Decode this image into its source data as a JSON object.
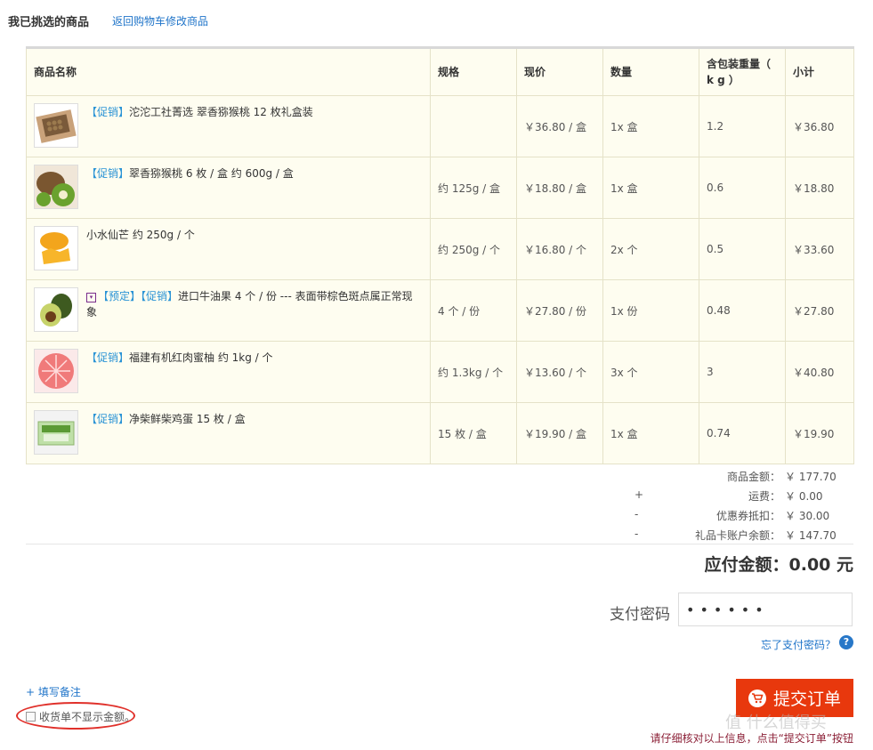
{
  "header": {
    "title": "我已挑选的商品",
    "back_link": "返回购物车修改商品"
  },
  "table": {
    "columns": [
      "商品名称",
      "规格",
      "现价",
      "数量",
      "含包装重量（ k g ）",
      "小计"
    ],
    "rows": [
      {
        "tags": [
          "【促销】"
        ],
        "name": "沱沱工社菁选  翠香猕猴桃 12 枚礼盒装",
        "spec": "",
        "price": "￥36.80 / 盒",
        "qty": "1x 盒",
        "weight": "1.2",
        "subtotal": "￥36.80",
        "thumb": "gift-box"
      },
      {
        "tags": [
          "【促销】"
        ],
        "name": "翠香猕猴桃 6 枚 / 盒 约 600g / 盒",
        "spec": "约 125g / 盒",
        "price": "￥18.80 / 盒",
        "qty": "1x 盒",
        "weight": "0.6",
        "subtotal": "￥18.80",
        "thumb": "kiwi"
      },
      {
        "tags": [],
        "name": "小水仙芒 约 250g / 个",
        "spec": "约 250g / 个",
        "price": "￥16.80 / 个",
        "qty": "2x 个",
        "weight": "0.5",
        "subtotal": "￥33.60",
        "thumb": "mango"
      },
      {
        "pre_icon": "▾",
        "tags": [
          "【预定】",
          "【促销】"
        ],
        "name": "进口牛油果 4 个 / 份 --- 表面带棕色斑点属正常现象",
        "spec": "4 个 / 份",
        "price": "￥27.80 / 份",
        "qty": "1x 份",
        "weight": "0.48",
        "subtotal": "￥27.80",
        "thumb": "avocado"
      },
      {
        "tags": [
          "【促销】"
        ],
        "name": "福建有机红肉蜜柚 约 1kg / 个",
        "spec": "约 1.3kg / 个",
        "price": "￥13.60 / 个",
        "qty": "3x 个",
        "weight": "3",
        "subtotal": "￥40.80",
        "thumb": "pomelo"
      },
      {
        "tags": [
          "【促销】"
        ],
        "name": "净柴鲜柴鸡蛋 15 枚 / 盒",
        "spec": "15 枚 / 盒",
        "price": "￥19.90 / 盒",
        "qty": "1x 盒",
        "weight": "0.74",
        "subtotal": "￥19.90",
        "thumb": "eggs"
      }
    ]
  },
  "summary": {
    "items": [
      {
        "sign": "",
        "label": "商品金额：",
        "value": "￥ 177.70"
      },
      {
        "sign": "+",
        "label": "运费：",
        "value": "￥ 0.00"
      },
      {
        "sign": "-",
        "label": "优惠券抵扣：",
        "value": "￥ 30.00"
      },
      {
        "sign": "-",
        "label": "礼品卡账户余额：",
        "value": "￥ 147.70"
      }
    ],
    "payable": "应付金额：0.00 元"
  },
  "payment": {
    "password_label": "支付密码",
    "password_value": "••••••",
    "forgot_link": "忘了支付密码？",
    "help_icon": "?"
  },
  "bottom": {
    "note_link": "+ 填写备注",
    "hide_amount_label": "收货单不显示金额。",
    "submit_label": "提交订单",
    "confirm_tip": "请仔细核对以上信息，点击“提交订单”按钮",
    "watermark": "值 什么值得买"
  },
  "colors": {
    "accent_button": "#e8380d",
    "link": "#1f74c9",
    "tag": "#2a93d5",
    "table_bg": "#fefdf0",
    "highlight_oval": "#e0302a"
  }
}
